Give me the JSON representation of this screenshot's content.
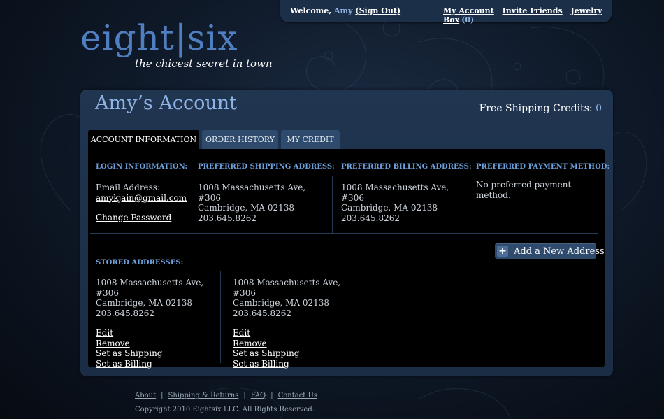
{
  "topbar": {
    "welcome_prefix": "Welcome,",
    "user_name": "Amy",
    "sign_out": "(Sign Out)",
    "my_account": "My Account",
    "invite_friends": "Invite Friends",
    "jewelry_box": "Jewelry Box",
    "jewelry_count": "(0)"
  },
  "logo": {
    "wordmark": "eight|six",
    "tagline": "the chicest secret in town"
  },
  "page": {
    "title": "Amy’s Account",
    "shipping_credits_label": "Free Shipping Credits:",
    "shipping_credits_value": "0"
  },
  "tabs": [
    {
      "label": "ACCOUNT INFORMATION",
      "active": true
    },
    {
      "label": "ORDER HISTORY",
      "active": false
    },
    {
      "label": "MY CREDIT",
      "active": false
    }
  ],
  "sections": {
    "login": {
      "header": "LOGIN INFORMATION:",
      "email_label": "Email Address:",
      "email": "amykjain@gmail.com",
      "change_password": "Change Password"
    },
    "shipping": {
      "header": "PREFERRED SHIPPING ADDRESS:",
      "line1": "1008 Massachusetts Ave, #306",
      "line2": "Cambridge, MA 02138",
      "phone": "203.645.8262"
    },
    "billing": {
      "header": "PREFERRED BILLING ADDRESS:",
      "line1": "1008 Massachusetts Ave, #306",
      "line2": "Cambridge, MA 02138",
      "phone": "203.645.8262"
    },
    "payment": {
      "header": "PREFERRED PAYMENT METHOD:",
      "text": "No preferred payment method."
    }
  },
  "add_address_button": "Add a New Address",
  "stored": {
    "header": "STORED ADDRESSES:",
    "addresses": [
      {
        "line1": "1008 Massachusetts Ave, #306",
        "line2": "Cambridge, MA 02138",
        "phone": "203.645.8262",
        "edit": "Edit",
        "remove": "Remove",
        "set_shipping": "Set as Shipping",
        "set_billing": "Set as Billing"
      },
      {
        "line1": "1008 Massachusetts Ave, #306",
        "line2": "Cambridge, MA 02138",
        "phone": "203.645.8262",
        "edit": "Edit",
        "remove": "Remove",
        "set_shipping": "Set as Shipping",
        "set_billing": "Set as Billing"
      }
    ]
  },
  "footer": {
    "links": [
      "About",
      "Shipping & Returns",
      "FAQ",
      "Contact Us"
    ],
    "separator": "|",
    "copyright": "Copyright 2010 Eightsix LLC. All Rights Reserved."
  },
  "colors": {
    "accent": "#8fb4e6",
    "header_blue": "#6d9fdc",
    "panel": "#1b2d45",
    "tab_inactive": "#2e4a6c",
    "content_bg": "#000000"
  },
  "icons": {
    "add": "plus-icon"
  }
}
